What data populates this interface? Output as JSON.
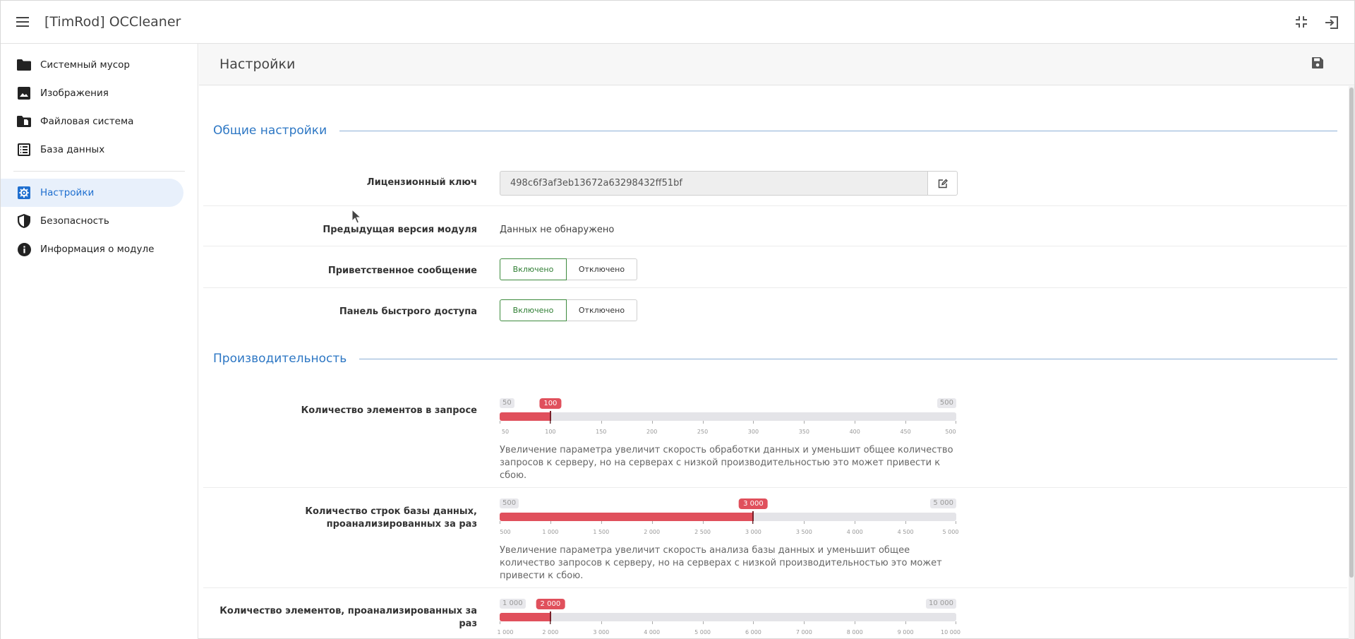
{
  "app": {
    "title": "[TimRod] OCCleaner"
  },
  "sidebar": {
    "items": [
      {
        "label": "Системный мусор",
        "icon": "folder-icon"
      },
      {
        "label": "Изображения",
        "icon": "image-icon"
      },
      {
        "label": "Файловая система",
        "icon": "folder-file-icon"
      },
      {
        "label": "База данных",
        "icon": "list-icon"
      },
      {
        "label": "Настройки",
        "icon": "gear-icon",
        "active": true
      },
      {
        "label": "Безопасность",
        "icon": "shield-icon"
      },
      {
        "label": "Информация о модуле",
        "icon": "info-icon"
      }
    ]
  },
  "page": {
    "title": "Настройки"
  },
  "general": {
    "legend": "Общие настройки",
    "license": {
      "label": "Лицензионный ключ",
      "value": "498c6f3af3eb13672a63298432ff51bf"
    },
    "prev_version": {
      "label": "Предыдущая версия модуля",
      "value": "Данных не обнаружено"
    },
    "welcome": {
      "label": "Приветственное сообщение",
      "on": "Включено",
      "off": "Отключено",
      "selected": "on"
    },
    "quick_panel": {
      "label": "Панель быстрого доступа",
      "on": "Включено",
      "off": "Отключено",
      "selected": "on"
    }
  },
  "performance": {
    "legend": "Производительность",
    "sliders": [
      {
        "label": "Количество элементов в запросе",
        "min": 50,
        "max": 500,
        "value": 100,
        "min_label": "50",
        "max_label": "500",
        "value_label": "100",
        "ticks": [
          "50",
          "100",
          "150",
          "200",
          "250",
          "300",
          "350",
          "400",
          "450",
          "500"
        ],
        "hint": "Увеличение параметра увеличит скорость обработки данных и уменьшит общее количество запросов к серверу, но на серверах с низкой производительностью это может привести к сбою."
      },
      {
        "label": "Количество строк базы данных, проанализированных за раз",
        "min": 500,
        "max": 5000,
        "value": 3000,
        "min_label": "500",
        "max_label": "5 000",
        "value_label": "3 000",
        "ticks": [
          "500",
          "1 000",
          "1 500",
          "2 000",
          "2 500",
          "3 000",
          "3 500",
          "4 000",
          "4 500",
          "5 000"
        ],
        "hint": "Увеличение параметра увеличит скорость анализа базы данных и уменьшит общее количество запросов к серверу, но на серверах с низкой производительностью это может привести к сбою."
      },
      {
        "label": "Количество элементов, проанализированных за раз",
        "min": 1000,
        "max": 10000,
        "value": 2000,
        "min_label": "1 000",
        "max_label": "10 000",
        "value_label": "2 000",
        "ticks": [
          "1 000",
          "2 000",
          "3 000",
          "4 000",
          "5 000",
          "6 000",
          "7 000",
          "8 000",
          "9 000",
          "10 000"
        ],
        "hint": ""
      }
    ]
  },
  "colors": {
    "accent": "#1f6fcf",
    "slider": "#e0505c",
    "toggle_on": "#2e7d32"
  }
}
